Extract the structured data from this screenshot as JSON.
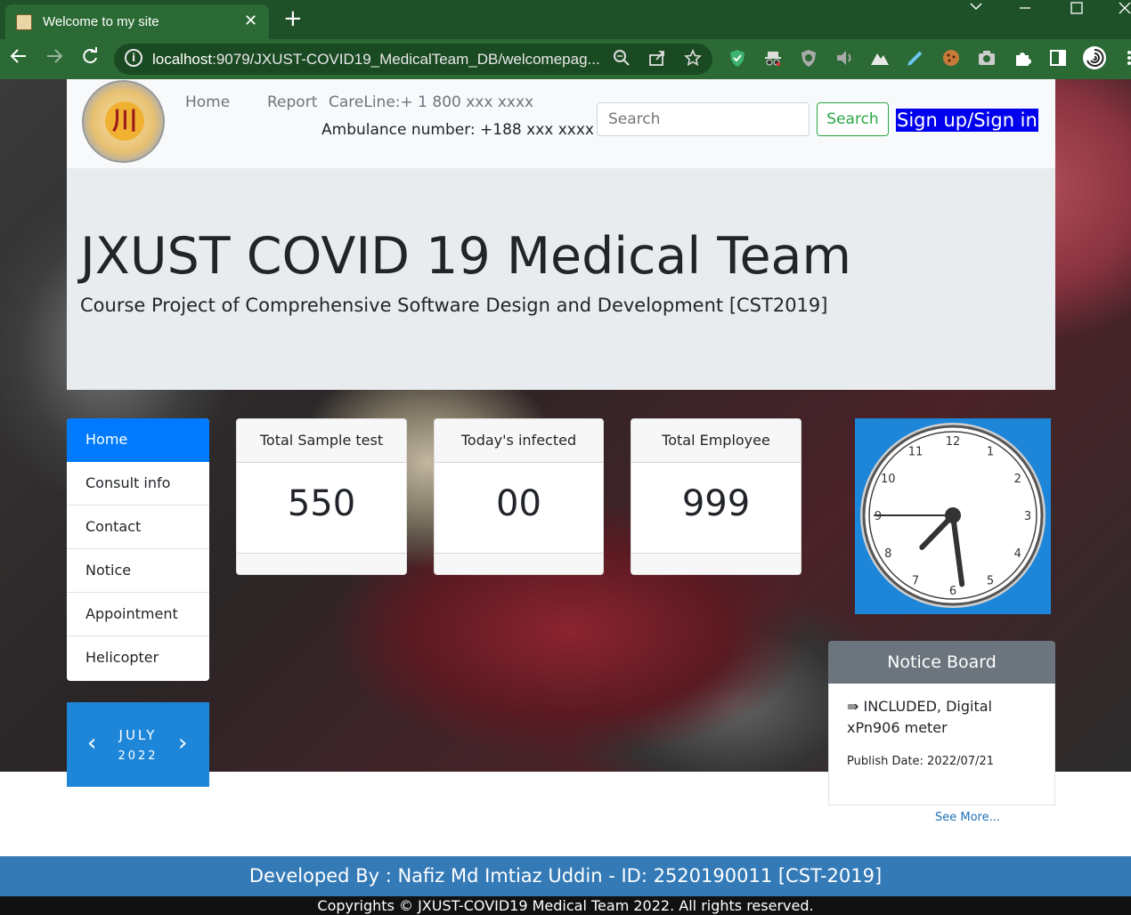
{
  "browser": {
    "tab_title": "Welcome to my site",
    "tab_close": "✕",
    "new_tab": "+",
    "url_host": "localhost",
    "url_rest": ":9079/JXUST-COVID19_MedicalTeam_DB/welcomepag...",
    "icons": [
      "back-icon",
      "forward-icon",
      "reload-icon",
      "info-icon",
      "zoom-icon",
      "share-icon",
      "star-icon",
      "extensions-icon",
      "profile-icon",
      "menu-icon"
    ]
  },
  "header": {
    "logo_glyph": "川",
    "nav": {
      "home": "Home",
      "report": "Report",
      "careline": "CareLine:+ 1 800 xxx xxxx"
    },
    "ambulance": "Ambulance number: +188 xxx xxxx",
    "search_placeholder": "Search",
    "search_button": "Search",
    "signup": "Sign up/Sign in"
  },
  "jumbotron": {
    "title": "JXUST COVID 19 Medical Team",
    "subtitle": "Course Project of Comprehensive Software Design and Development [CST2019]"
  },
  "sidebar": {
    "items": [
      {
        "label": "Home",
        "active": true
      },
      {
        "label": "Consult info"
      },
      {
        "label": "Contact"
      },
      {
        "label": "Notice"
      },
      {
        "label": "Appointment"
      },
      {
        "label": "Helicopter"
      }
    ]
  },
  "calendar": {
    "month": "JULY",
    "year": "2022",
    "prev": "‹",
    "next": "›"
  },
  "stats": [
    {
      "label": "Total Sample test",
      "value": "550"
    },
    {
      "label": "Today's infected",
      "value": "00"
    },
    {
      "label": "Total Employee",
      "value": "999"
    }
  ],
  "clock": {
    "numbers": [
      "12",
      "1",
      "2",
      "3",
      "4",
      "5",
      "6",
      "7",
      "8",
      "9",
      "10",
      "11"
    ],
    "time": {
      "hour": 7,
      "minute": 28,
      "second": 45
    }
  },
  "notice_board": {
    "title": "Notice Board",
    "text": "⇛ INCLUDED, Digital xPn906 meter",
    "date": "Publish Date: 2022/07/21",
    "see_more": "See More..."
  },
  "footer": {
    "developer": "Developed By : Nafiz Md Imtiaz Uddin - ID: 2520190011 [CST-2019]",
    "copyright": "Copyrights © JXUST-COVID19 Medical Team 2022. All rights reserved."
  }
}
